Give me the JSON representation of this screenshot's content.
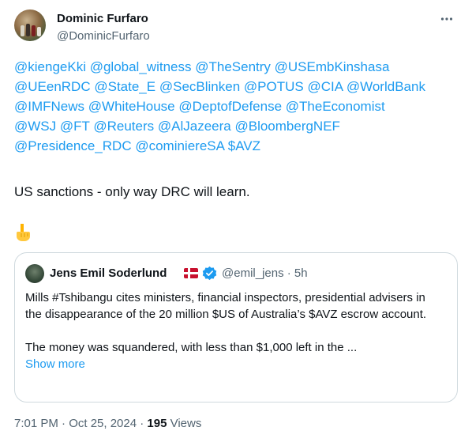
{
  "author": {
    "name": "Dominic Furfaro",
    "handle": "@DominicFurfaro"
  },
  "tweet": {
    "mentions_line1": [
      "@kiengeKki",
      "@global_witness",
      "@TheSentry",
      "@USEmbKinshasa"
    ],
    "mentions_line2": [
      "@UEenRDC",
      "@State_E",
      "@SecBlinken",
      "@POTUS",
      "@CIA",
      "@WorldBank"
    ],
    "mentions_line3": [
      "@IMFNews",
      "@WhiteHouse",
      "@DeptofDefense",
      "@TheEconomist"
    ],
    "mentions_line4": [
      "@WSJ",
      "@FT",
      "@Reuters",
      "@AlJazeera",
      "@BloombergNEF"
    ],
    "mentions_line5": [
      "@Presidence_RDC",
      "@cominiereSA",
      "$AVZ"
    ],
    "text": "US sanctions - only way DRC will learn."
  },
  "quote": {
    "name": "Jens Emil Soderlund",
    "handle_time": "@emil_jens · 5h",
    "para1": "Mills #Tshibangu cites ministers, financial inspectors, presidential advisers in the disappearance of the 20 million $US of Australia’s $AVZ escrow account.",
    "para2": "The money was squandered, with less than $1,000 left in the ...",
    "show_more": "Show more"
  },
  "footer": {
    "time": "7:01 PM · Oct 25, 2024 · ",
    "views_count": "195",
    "views_label": " Views"
  },
  "colors": {
    "link": "#1d9bf0",
    "secondary": "#536471",
    "border": "#cfd9de"
  },
  "icons": [
    "more-icon",
    "pointing-down-emoji",
    "denmark-flag-icon",
    "verified-badge-icon"
  ]
}
